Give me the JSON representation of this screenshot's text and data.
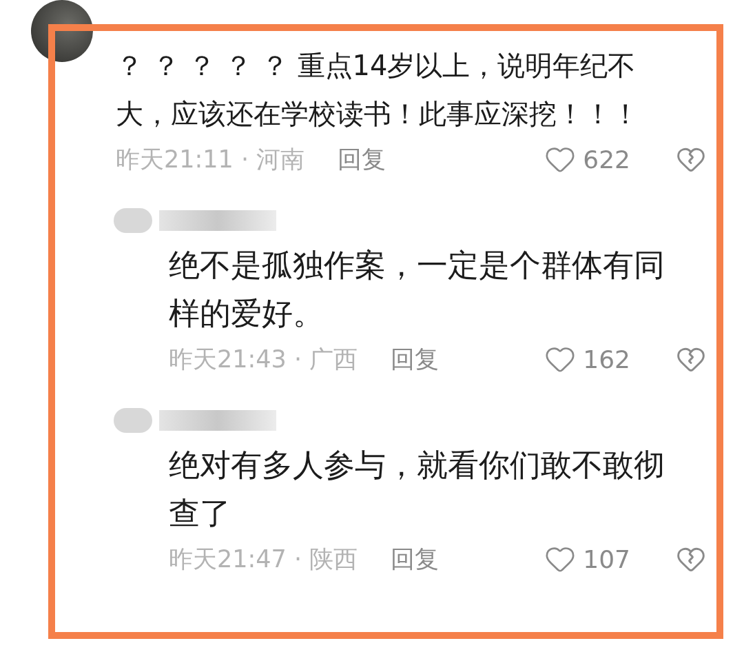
{
  "comments": [
    {
      "kind": "top",
      "text": "？ ？ ？ ？ ？ 重点14岁以上，说明年纪不大，应该还在学校读书！此事应深挖！！！",
      "meta": "昨天21:11 · 河南",
      "reply": "回复",
      "likes": "622"
    },
    {
      "kind": "reply",
      "text": "绝不是孤独作案，一定是个群体有同样的爱好。",
      "meta": "昨天21:43 · 广西",
      "reply": "回复",
      "likes": "162"
    },
    {
      "kind": "reply",
      "text": "绝对有多人参与，就看你们敢不敢彻查了",
      "meta": "昨天21:47 · 陕西",
      "reply": "回复",
      "likes": "107"
    }
  ],
  "highlight": {
    "color": "#f5804a"
  }
}
